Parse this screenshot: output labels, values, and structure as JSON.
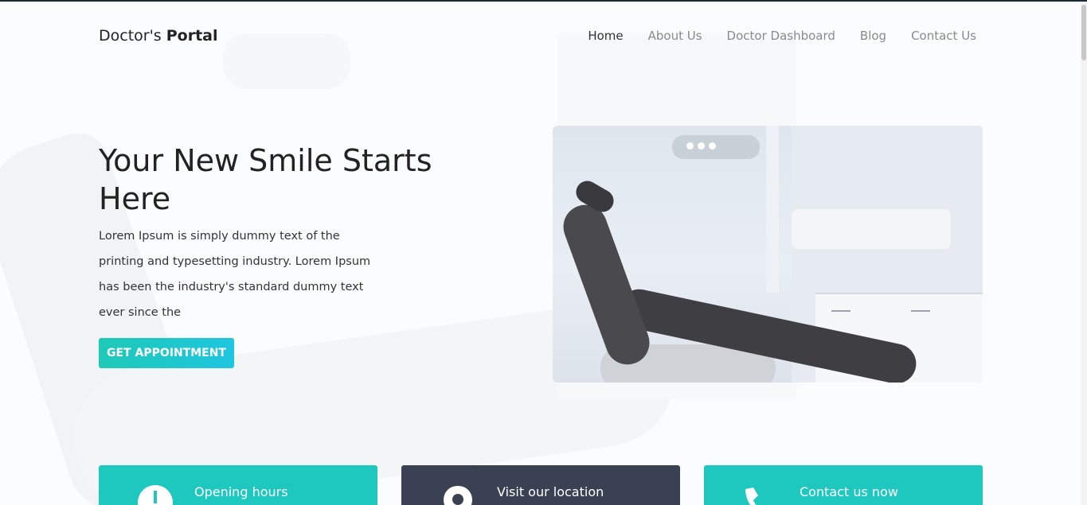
{
  "brand": {
    "light": "Doctor's ",
    "bold": "Portal"
  },
  "nav": {
    "home": "Home",
    "about": "About Us",
    "dashboard": "Doctor Dashboard",
    "blog": "Blog",
    "contact": "Contact Us"
  },
  "hero": {
    "title": "Your New Smile Starts Here",
    "description": "Lorem Ipsum is simply dummy text of the printing and typesetting industry. Lorem Ipsum has been the industry's standard dummy text ever since the",
    "cta_label": "GET APPOINTMENT",
    "image_icon": "dental-chair-photo"
  },
  "cards": {
    "hours": {
      "title": "Opening hours",
      "icon": "clock-icon"
    },
    "location": {
      "title": "Visit our location",
      "icon": "location-pin-icon"
    },
    "contact": {
      "title": "Contact us now",
      "icon": "phone-icon"
    }
  },
  "colors": {
    "accent": "#1ec8bf",
    "dark_card": "#3a4153",
    "cta_gradient_start": "#1ec9b6",
    "cta_gradient_end": "#1fc6e0"
  }
}
